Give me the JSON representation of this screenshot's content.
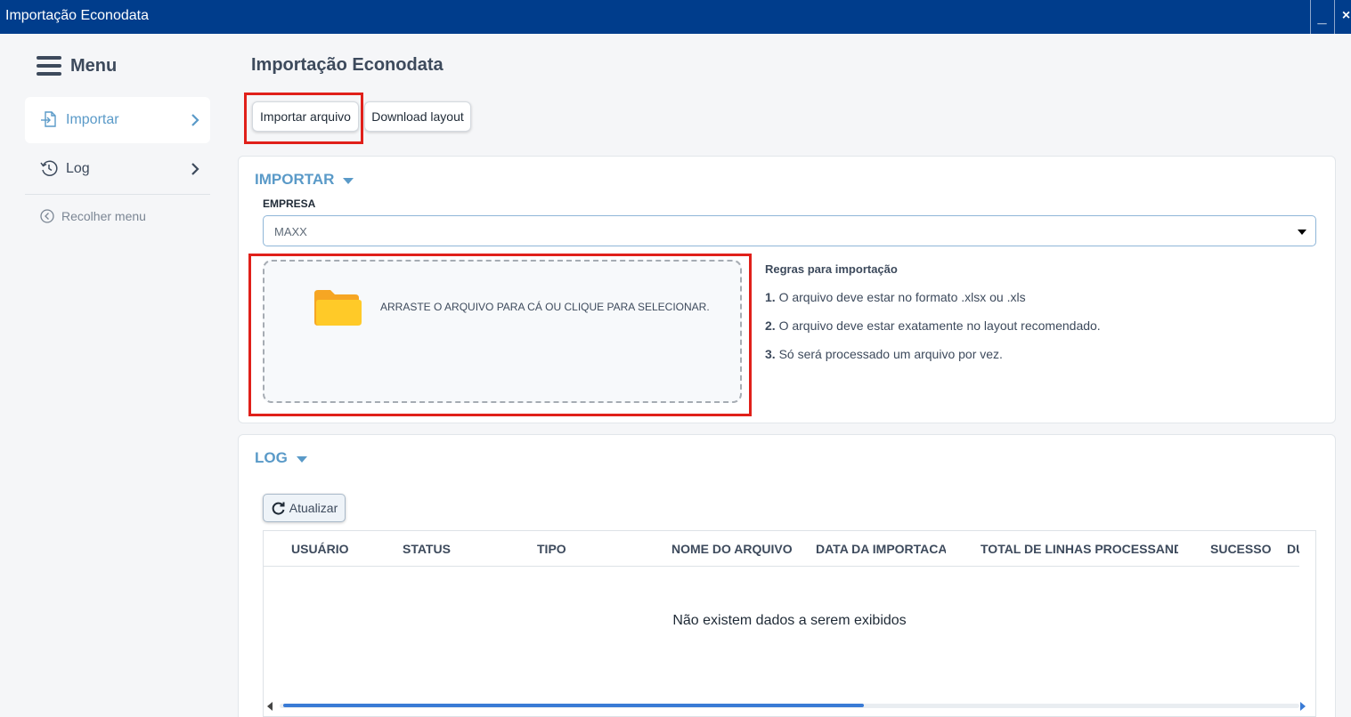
{
  "window": {
    "title": "Importação Econodata",
    "minimize_label": "_",
    "close_label": "×"
  },
  "sidebar": {
    "menu_label": "Menu",
    "items": [
      {
        "label": "Importar",
        "icon": "file-import-icon",
        "active": true
      },
      {
        "label": "Log",
        "icon": "history-icon",
        "active": false
      }
    ],
    "collapse_label": "Recolher menu"
  },
  "page": {
    "title": "Importação Econodata"
  },
  "toolbar": {
    "import_file_label": "Importar arquivo",
    "download_layout_label": "Download layout"
  },
  "import_section": {
    "title": "IMPORTAR",
    "company_label": "EMPRESA",
    "company_value": "MAXX",
    "dropzone_text": "ARRASTE O ARQUIVO PARA CÁ OU CLIQUE PARA SELECIONAR.",
    "rules_title": "Regras para importação",
    "rules": [
      {
        "num": "1.",
        "text": "O arquivo deve estar no formato .xlsx ou .xls"
      },
      {
        "num": "2.",
        "text": "O arquivo deve estar exatamente no layout recomendado."
      },
      {
        "num": "3.",
        "text": "Só será processado um arquivo por vez."
      }
    ]
  },
  "log_section": {
    "title": "LOG",
    "refresh_label": "Atualizar",
    "columns": [
      "USUÁRIO",
      "STATUS",
      "TIPO",
      "NOME DO ARQUIVO",
      "DATA DA IMPORTACAO",
      "TOTAL DE LINHAS PROCESSANDO",
      "SUCESSO",
      "DUPLICADOS"
    ],
    "empty_message": "Não existem dados a serem exibidos"
  },
  "colors": {
    "titlebar": "#003d8c",
    "accent": "#5a9ac8",
    "highlight": "#e0201a",
    "folder": "#f6a623"
  }
}
